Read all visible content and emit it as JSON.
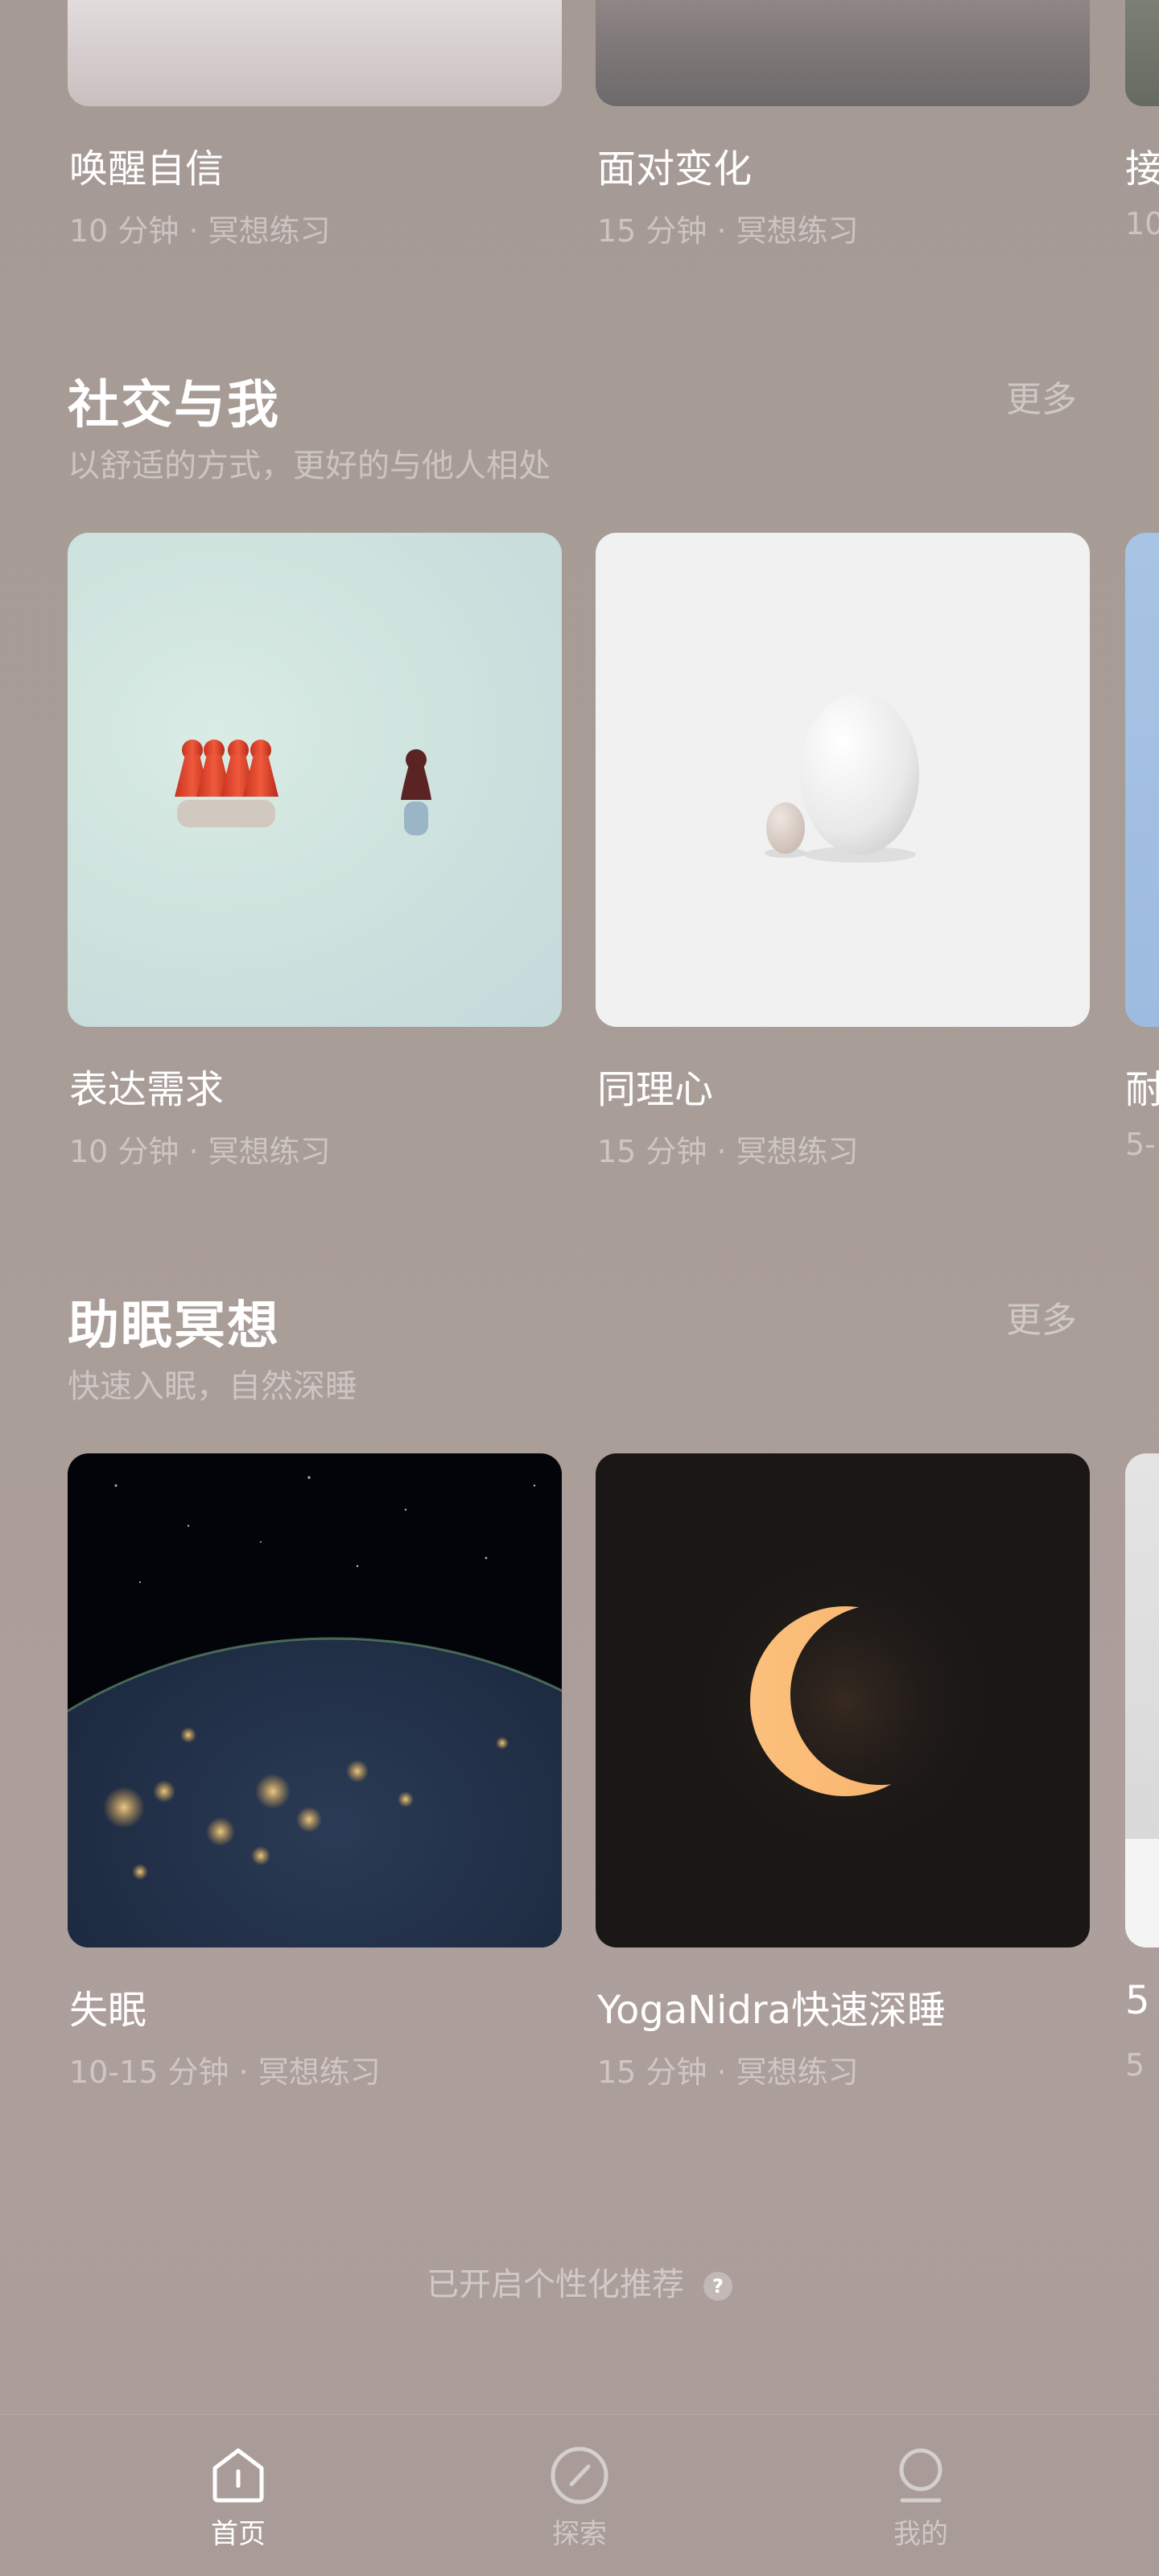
{
  "top_row": {
    "cards": [
      {
        "title": "唤醒自信",
        "meta": "10 分钟 · 冥想练习"
      },
      {
        "title": "面对变化",
        "meta": "15 分钟 · 冥想练习"
      },
      {
        "title": "接",
        "meta": "10"
      }
    ]
  },
  "social": {
    "title": "社交与我",
    "subtitle": "以舒适的方式，更好的与他人相处",
    "more": "更多",
    "cards": [
      {
        "title": "表达需求",
        "meta": "10 分钟 · 冥想练习"
      },
      {
        "title": "同理心",
        "meta": "15 分钟 · 冥想练习"
      },
      {
        "title": "耐",
        "meta": "5-"
      }
    ]
  },
  "sleep": {
    "title": "助眠冥想",
    "subtitle": "快速入眠，自然深睡",
    "more": "更多",
    "cards": [
      {
        "title": "失眠",
        "meta": "10-15 分钟 · 冥想练习"
      },
      {
        "title": "YogaNidra快速深睡",
        "meta": "15 分钟 · 冥想练习"
      },
      {
        "title": "5",
        "meta": "5"
      }
    ]
  },
  "recommendation": {
    "text": "已开启个性化推荐",
    "help": "?"
  },
  "nav": {
    "items": [
      {
        "label": "首页",
        "icon": "home-icon",
        "active": true
      },
      {
        "label": "探索",
        "icon": "compass-icon",
        "active": false
      },
      {
        "label": "我的",
        "icon": "profile-icon",
        "active": false
      }
    ]
  },
  "colors": {
    "background": "#a99d98",
    "text": "#ffffff",
    "muted": "rgba(255,255,255,0.42)"
  }
}
